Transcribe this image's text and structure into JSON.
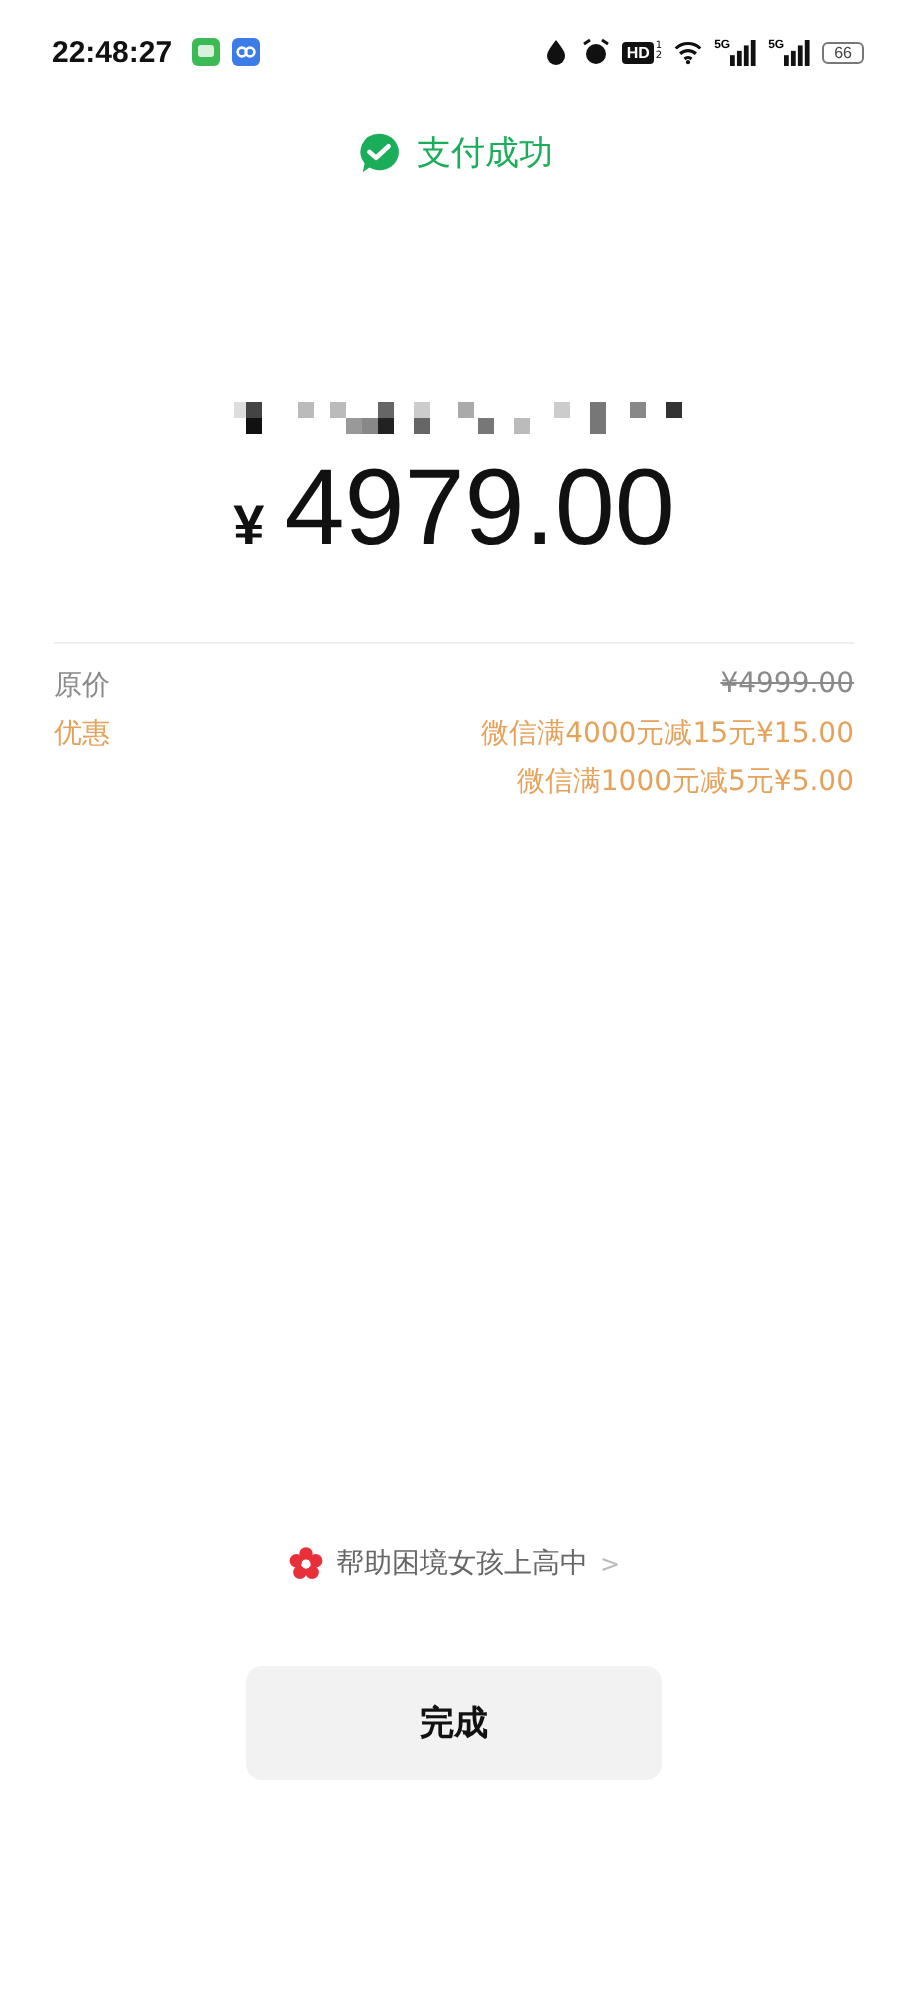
{
  "status_bar": {
    "time": "22:48:27",
    "hd_label": "HD",
    "hd_sims": [
      "1",
      "2"
    ],
    "signal_labels": [
      "5G",
      "5G"
    ],
    "battery": "66"
  },
  "header": {
    "title": "支付成功"
  },
  "payment": {
    "currency": "¥",
    "amount": "4979.00"
  },
  "details": [
    {
      "kind": "original",
      "label": "原价",
      "values": [
        "¥4999.00"
      ]
    },
    {
      "kind": "discount",
      "label": "优惠",
      "values": [
        "微信满4000元减15元¥15.00",
        "微信满1000元减5元¥5.00"
      ]
    }
  ],
  "charity_link": {
    "label": "帮助困境女孩上高中",
    "chevron": ">"
  },
  "done_button": {
    "label": "完成"
  }
}
